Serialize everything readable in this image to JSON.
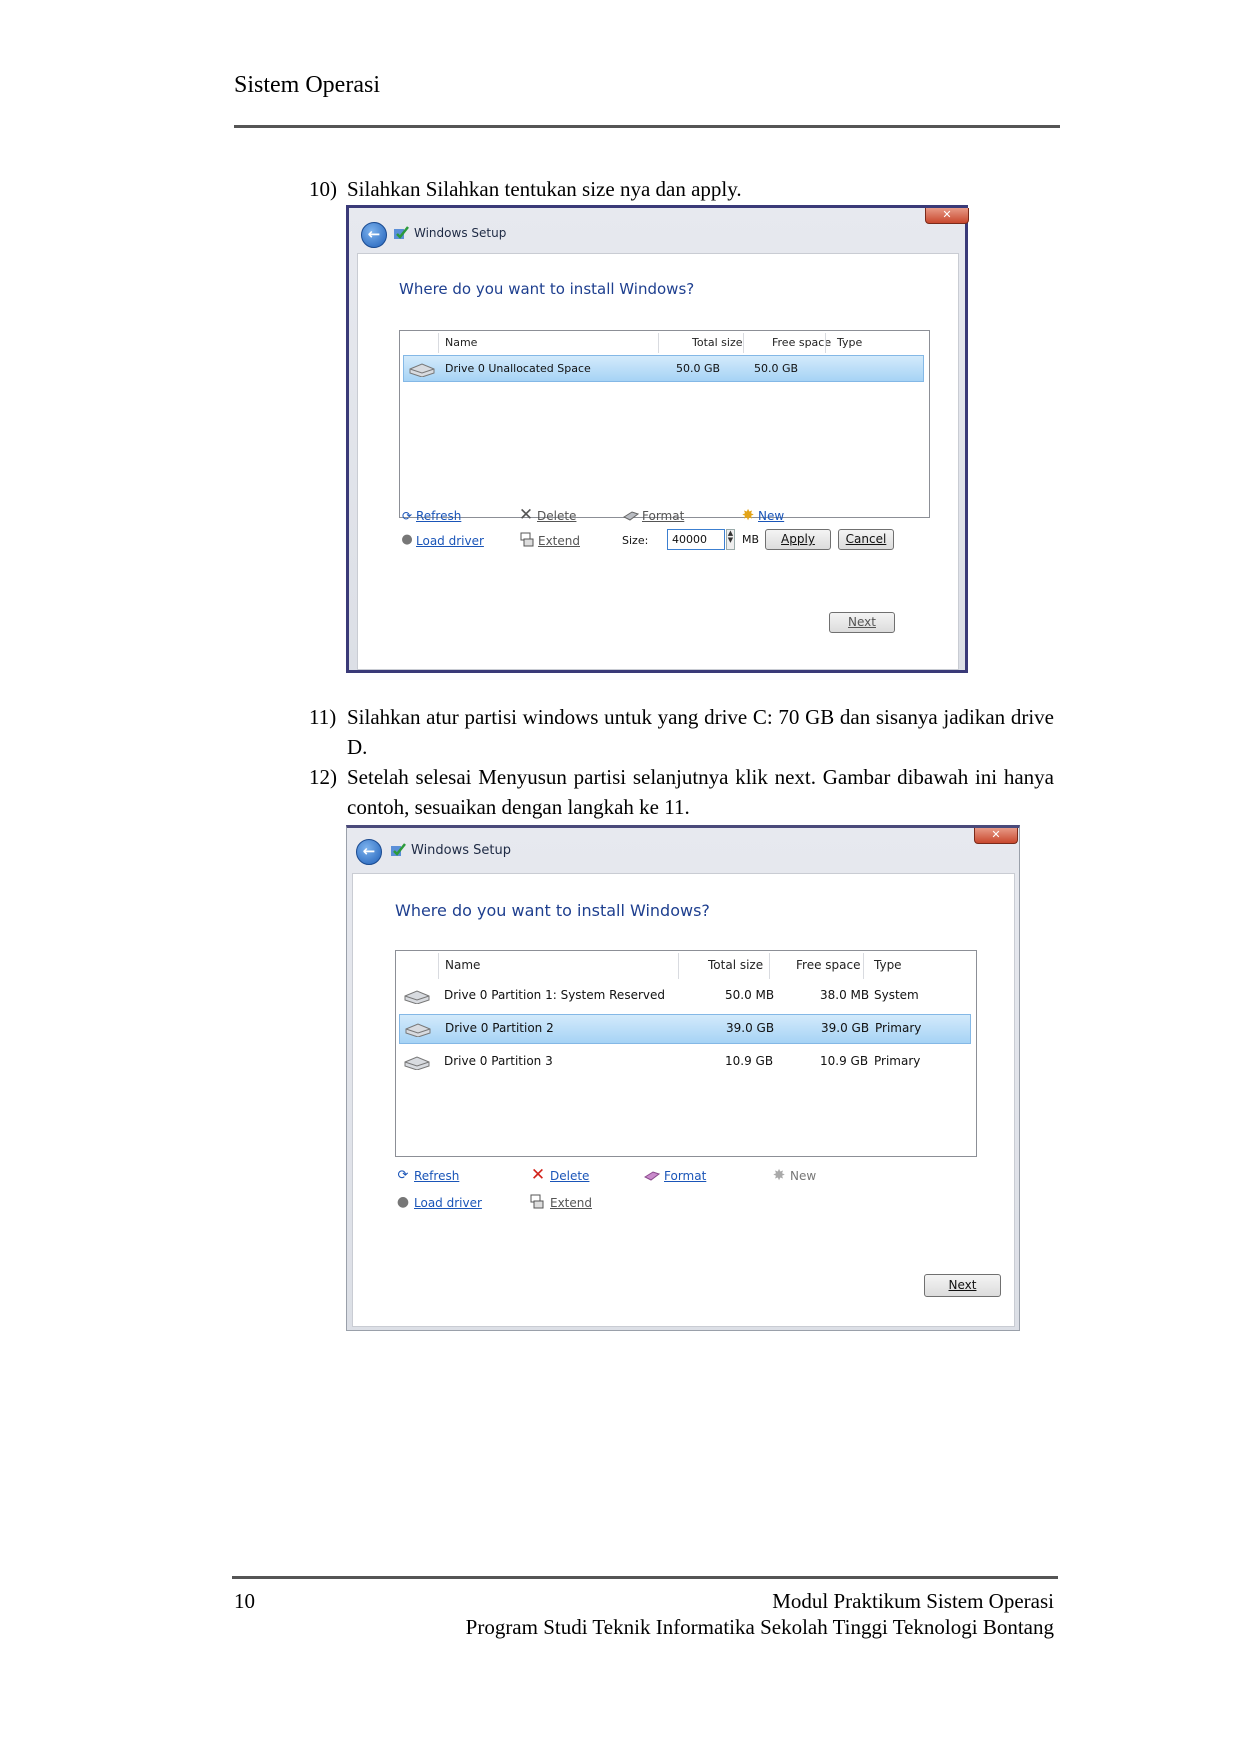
{
  "header": {
    "title": "Sistem Operasi"
  },
  "steps": [
    {
      "num": "10)",
      "text": "Silahkan Silahkan tentukan size nya dan apply."
    },
    {
      "num": "11)",
      "text": "Silahkan atur partisi windows untuk yang drive C: 70 GB dan sisanya jadikan drive D."
    },
    {
      "num": "12)",
      "text": "Setelah selesai Menyusun partisi selanjutnya klik next. Gambar dibawah ini hanya contoh, sesuaikan dengan langkah ke 11."
    }
  ],
  "screenshot1": {
    "window_title": "Windows Setup",
    "question": "Where do you want to install Windows?",
    "columns": {
      "name": "Name",
      "total": "Total size",
      "free": "Free space",
      "type": "Type"
    },
    "rows": [
      {
        "name": "Drive 0 Unallocated Space",
        "total": "50.0 GB",
        "free": "50.0 GB",
        "type": ""
      }
    ],
    "actions": {
      "refresh": "Refresh",
      "delete": "Delete",
      "format": "Format",
      "new": "New",
      "load_driver": "Load driver",
      "extend": "Extend"
    },
    "size_label": "Size:",
    "size_value": "40000",
    "size_unit": "MB",
    "apply": "Apply",
    "cancel": "Cancel",
    "next": "Next"
  },
  "screenshot2": {
    "window_title": "Windows Setup",
    "question": "Where do you want to install Windows?",
    "columns": {
      "name": "Name",
      "total": "Total size",
      "free": "Free space",
      "type": "Type"
    },
    "rows": [
      {
        "name": "Drive 0 Partition 1: System Reserved",
        "total": "50.0 MB",
        "free": "38.0 MB",
        "type": "System"
      },
      {
        "name": "Drive 0 Partition 2",
        "total": "39.0 GB",
        "free": "39.0 GB",
        "type": "Primary"
      },
      {
        "name": "Drive 0 Partition 3",
        "total": "10.9 GB",
        "free": "10.9 GB",
        "type": "Primary"
      }
    ],
    "actions": {
      "refresh": "Refresh",
      "delete": "Delete",
      "format": "Format",
      "new": "New",
      "load_driver": "Load driver",
      "extend": "Extend"
    },
    "next": "Next"
  },
  "footer": {
    "page_number": "10",
    "module": "Modul Praktikum Sistem Operasi",
    "institution": "Program Studi Teknik Informatika Sekolah Tinggi Teknologi Bontang"
  }
}
